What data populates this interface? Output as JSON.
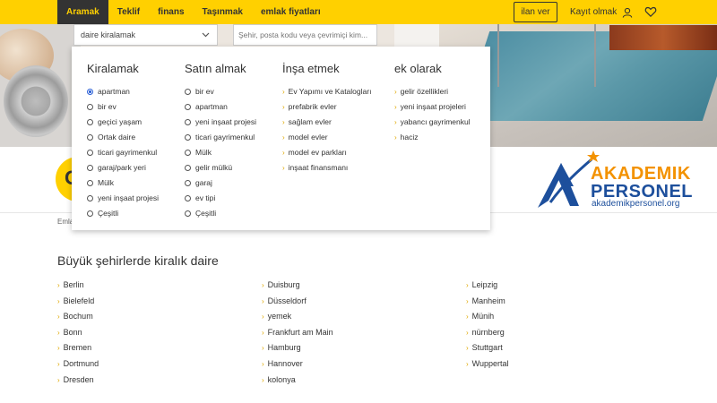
{
  "nav": {
    "items": [
      {
        "label": "Aramak",
        "active": true
      },
      {
        "label": "Teklif",
        "active": false
      },
      {
        "label": "finans",
        "active": false
      },
      {
        "label": "Taşınmak",
        "active": false
      },
      {
        "label": "emlak fiyatları",
        "active": false
      }
    ],
    "post_ad_label": "ilan ver",
    "login_label": "Kayıt olmak",
    "colors": {
      "bar": "#ffd000",
      "active_bg": "#333333"
    }
  },
  "search": {
    "type_value": "daire kiralamak",
    "location_placeholder": "Şehir, posta kodu veya çevrimiçi kim..."
  },
  "mega_menu": {
    "columns": [
      {
        "title": "Kiralamak",
        "kind": "radio",
        "items": [
          {
            "label": "apartman",
            "selected": true
          },
          {
            "label": "bir ev",
            "selected": false
          },
          {
            "label": "geçici yaşam",
            "selected": false
          },
          {
            "label": "Ortak daire",
            "selected": false
          },
          {
            "label": "ticari gayrimenkul",
            "selected": false
          },
          {
            "label": "garaj/park yeri",
            "selected": false
          },
          {
            "label": "Mülk",
            "selected": false
          },
          {
            "label": "yeni inşaat projesi",
            "selected": false
          },
          {
            "label": "Çeşitli",
            "selected": false
          }
        ]
      },
      {
        "title": "Satın almak",
        "kind": "radio",
        "items": [
          {
            "label": "bir ev",
            "selected": false
          },
          {
            "label": "apartman",
            "selected": false
          },
          {
            "label": "yeni inşaat projesi",
            "selected": false
          },
          {
            "label": "ticari gayrimenkul",
            "selected": false
          },
          {
            "label": "Mülk",
            "selected": false
          },
          {
            "label": "gelir mülkü",
            "selected": false
          },
          {
            "label": "garaj",
            "selected": false
          },
          {
            "label": "ev tipi",
            "selected": false
          },
          {
            "label": "Çeşitli",
            "selected": false
          }
        ]
      },
      {
        "title": "İnşa etmek",
        "kind": "link",
        "items": [
          {
            "label": "Ev Yapımı ve Katalogları"
          },
          {
            "label": "prefabrik evler"
          },
          {
            "label": "sağlam evler"
          },
          {
            "label": "model evler"
          },
          {
            "label": "model ev parkları"
          },
          {
            "label": "inşaat finansmanı"
          }
        ]
      },
      {
        "title": "ek olarak",
        "kind": "link",
        "items": [
          {
            "label": "gelir özellikleri"
          },
          {
            "label": "yeni inşaat projeleri"
          },
          {
            "label": "yabancı gayrimenkul"
          },
          {
            "label": "haciz"
          }
        ]
      }
    ]
  },
  "promo": {
    "circle_text": "O",
    "logo_line1": "AKADEMIK",
    "logo_line2": "PERSONEL",
    "logo_url": "akademikpersonel.org"
  },
  "breadcrumb": "Emla",
  "cities": {
    "title": "Büyük şehirlerde kiralık daire",
    "columns": [
      [
        "Berlin",
        "Bielefeld",
        "Bochum",
        "Bonn",
        "Bremen",
        "Dortmund",
        "Dresden"
      ],
      [
        "Duisburg",
        "Düsseldorf",
        "yemek",
        "Frankfurt am Main",
        "Hamburg",
        "Hannover",
        "kolonya"
      ],
      [
        "Leipzig",
        "Manheim",
        "Münih",
        "nürnberg",
        "Stuttgart",
        "Wuppertal"
      ]
    ]
  }
}
